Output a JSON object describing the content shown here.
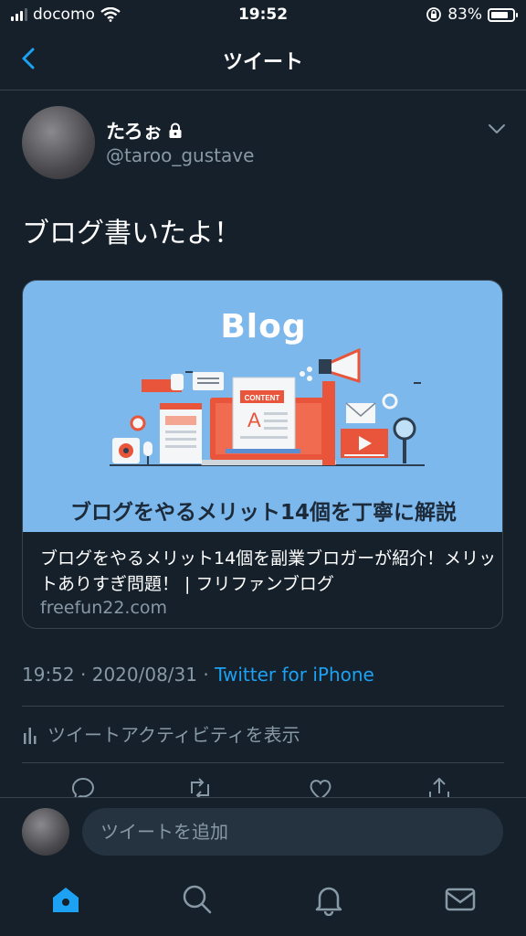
{
  "status": {
    "carrier": "docomo",
    "time": "19:52",
    "battery": "83%",
    "battery_level": 0.83
  },
  "header": {
    "title": "ツイート"
  },
  "author": {
    "name": "たろぉ",
    "handle": "@taroo_gustave",
    "locked": true
  },
  "tweet": {
    "text": "ブログ書いたよ！"
  },
  "card": {
    "image_title": "Blog",
    "image_tag": "CONTENT",
    "image_letter": "A",
    "image_banner": "ブログをやるメリット14個を丁寧に解説",
    "title": "ブログをやるメリット14個を副業ブロガーが紹介！メリットありすぎ問題！ | フリファンブログ",
    "domain": "freefun22.com"
  },
  "meta": {
    "time": "19:52",
    "date": "2020/08/31",
    "source": "Twitter for iPhone"
  },
  "activity": {
    "label": "ツイートアクティビティを表示"
  },
  "reply": {
    "placeholder": "ツイートを追加"
  },
  "colors": {
    "background": "#15202b",
    "accent": "#1da1f2",
    "muted": "#8899a6",
    "border": "#38444d",
    "card_bg": "#7cb8ec"
  },
  "icons": {
    "tabs": [
      "home-icon",
      "search-icon",
      "bell-icon",
      "mail-icon"
    ],
    "actions": [
      "reply-icon",
      "retweet-icon",
      "like-icon",
      "share-icon"
    ]
  }
}
